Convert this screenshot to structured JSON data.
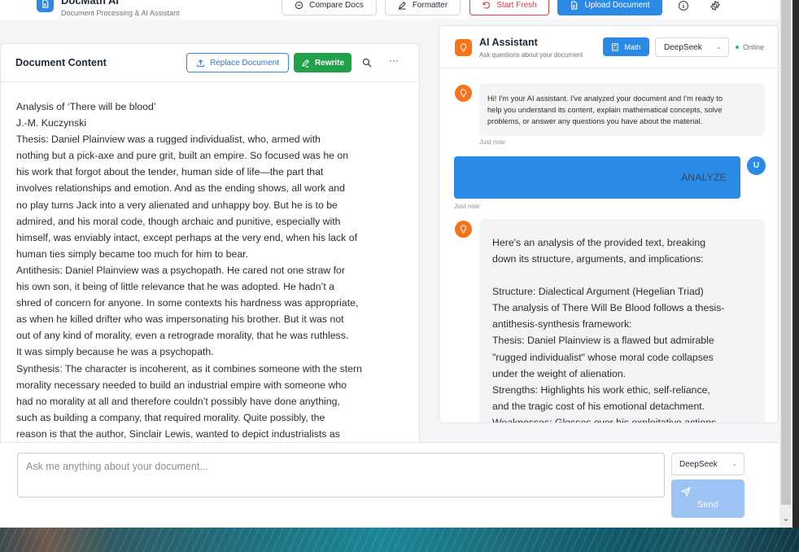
{
  "app": {
    "title": "DocMath AI",
    "subtitle": "Document Processing & AI Assistant"
  },
  "toolbar": {
    "compare_label": "Compare Docs",
    "formatter_label": "Formatter",
    "start_fresh_label": "Start Fresh",
    "upload_label": "Upload Document",
    "icons": [
      "file-compare-icon",
      "edit-icon",
      "reset-icon",
      "upload-icon",
      "info-icon",
      "settings-icon"
    ]
  },
  "document": {
    "heading": "Document Content",
    "replace_label": "Replace Document",
    "rewrite_label": "Rewrite",
    "lines": [
      "Analysis of ‘There will be blood’",
      "J.-M. Kuczynski",
      "Thesis: Daniel Plainview was a rugged individualist, who, armed with",
      "nothing but a pick-axe and pure grit, built an empire. So focused was he on",
      "his work that forgot about the tender, human side of life—the part that",
      "involves relationships and emotion. And as the ending shows, all work and",
      "no play turns Jack into a very alienated and unhappy boy. But he is to be",
      "admired, and his moral code, though archaic and punitive, especially with",
      "himself, was enviably intact, except perhaps at the very end, when his lack of",
      "human ties simply became too much for him to bear.",
      "Antithesis: Daniel Plainview was a psychopath. He cared not one straw for",
      "his own son, it being of little relevance that he was adopted. He hadn’t a",
      "shred of concern for anyone. In some contexts his hardness was appropriate,",
      "as when he killed drifter who was impersonating his brother. But it was not",
      "out of any kind of morality, even a retrograde morality, that he was ruthless.",
      "It was simply because he was a psychopath.",
      "Synthesis: The character is incoherent, as it combines someone with the stern",
      "morality necessary needed to build an industrial empire with someone who",
      "had no morality at all and therefore couldn’t possibly have done anything,",
      "such as building a company, that required morality. Quite possibly, the",
      "reason is that the author, Sinclair Lewis, wanted to depict industrialists as"
    ]
  },
  "assistant": {
    "title": "AI Assistant",
    "subtitle": "Ask questions about your document",
    "math_label": "Math",
    "model": "DeepSeek",
    "status": "Online",
    "messages": [
      {
        "role": "assistant",
        "lines": [
          "Hi! I'm your AI assistant. I've analyzed your document and I'm ready to",
          "help you understand its content, explain mathematical concepts, solve",
          "problems, or answer any questions you have about the material."
        ],
        "time": "Just now"
      },
      {
        "role": "user",
        "avatar": "U",
        "text": "ANALYZE",
        "time": "Just now"
      },
      {
        "role": "assistant",
        "lines": [
          "Here's an analysis of the provided text, breaking",
          "down its structure, arguments, and implications:",
          "",
          "Structure: Dialectical Argument (Hegelian Triad)",
          "The analysis of There Will Be Blood follows a thesis-",
          "antithesis-synthesis framework:",
          "Thesis: Daniel Plainview is a flawed but admirable",
          "\"rugged individualist\" whose moral code collapses",
          "under the weight of alienation.",
          "Strengths: Highlights his work ethic, self-reliance,",
          "and the tragic cost of his emotional detachment.",
          "Weaknesses: Glosses over his exploitative actions"
        ]
      }
    ]
  },
  "composer": {
    "placeholder": "Ask me anything about your document...",
    "value": "",
    "model": "DeepSeek",
    "send_label": "Send"
  }
}
